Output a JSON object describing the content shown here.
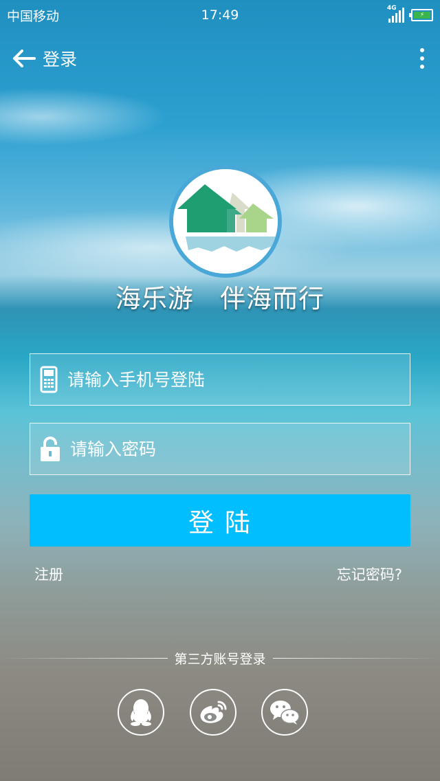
{
  "status_bar": {
    "carrier": "中国移动",
    "time": "17:49",
    "network": "4G"
  },
  "header": {
    "title": "登录"
  },
  "brand": {
    "slogan": "海乐游   伴海而行"
  },
  "form": {
    "phone_placeholder": "请输入手机号登陆",
    "password_placeholder": "请输入密码",
    "login_label": "登 陆"
  },
  "links": {
    "register": "注册",
    "forgot": "忘记密码?"
  },
  "third_party": {
    "title": "第三方账号登录",
    "providers": [
      "qq-icon",
      "weibo-icon",
      "wechat-icon"
    ]
  },
  "colors": {
    "primary": "#00beff",
    "logo_ring": "#49a8d8",
    "battery": "#39b54a"
  }
}
